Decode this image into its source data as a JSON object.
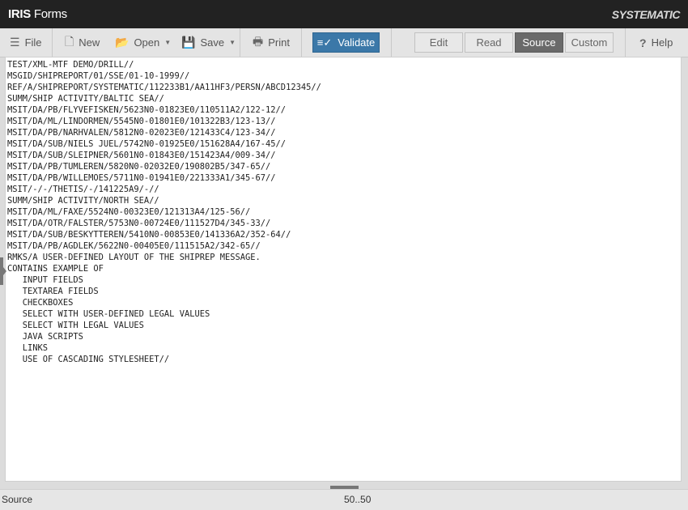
{
  "app": {
    "brand_bold": "IRIS",
    "brand_rest": " Forms",
    "vendor": "SYSTEMATIC"
  },
  "toolbar": {
    "file": "File",
    "new": "New",
    "open": "Open",
    "save": "Save",
    "print": "Print",
    "validate": "Validate",
    "help": "Help"
  },
  "modes": {
    "edit": "Edit",
    "read": "Read",
    "source": "Source",
    "custom": "Custom",
    "active": "Source"
  },
  "editor": {
    "lines": [
      "TEST/XML-MTF DEMO/DRILL//",
      "MSGID/SHIPREPORT/01/SSE/01-10-1999//",
      "REF/A/SHIPREPORT/SYSTEMATIC/112233B1/AA11HF3/PERSN/ABCD12345//",
      "SUMM/SHIP ACTIVITY/BALTIC SEA//",
      "MSIT/DA/PB/FLYVEFISKEN/5623N0-01823E0/110511A2/122-12//",
      "MSIT/DA/ML/LINDORMEN/5545N0-01801E0/101322B3/123-13//",
      "MSIT/DA/PB/NARHVALEN/5812N0-02023E0/121433C4/123-34//",
      "MSIT/DA/SUB/NIELS JUEL/5742N0-01925E0/151628A4/167-45//",
      "MSIT/DA/SUB/SLEIPNER/5601N0-01843E0/151423A4/009-34//",
      "MSIT/DA/PB/TUMLEREN/5820N0-02032E0/190802B5/347-65//",
      "MSIT/DA/PB/WILLEMOES/5711N0-01941E0/221333A1/345-67//",
      "MSIT/-/-/THETIS/-/141225A9/-//",
      "SUMM/SHIP ACTIVITY/NORTH SEA//",
      "MSIT/DA/ML/FAXE/5524N0-00323E0/121313A4/125-56//",
      "MSIT/DA/OTR/FALSTER/5753N0-00724E0/111527D4/345-33//",
      "MSIT/DA/SUB/BESKYTTEREN/5410N0-00853E0/141336A2/352-64//",
      "MSIT/DA/PB/AGDLEK/5622N0-00405E0/111515A2/342-65//",
      "RMKS/A USER-DEFINED LAYOUT OF THE SHIPREP MESSAGE.",
      "CONTAINS EXAMPLE OF",
      "   INPUT FIELDS",
      "   TEXTAREA FIELDS",
      "   CHECKBOXES",
      "   SELECT WITH USER-DEFINED LEGAL VALUES",
      "   SELECT WITH LEGAL VALUES",
      "   JAVA SCRIPTS",
      "   LINKS",
      "   USE OF CASCADING STYLESHEET//"
    ]
  },
  "status": {
    "mode": "Source",
    "position": "50..50"
  },
  "colors": {
    "titlebar": "#222222",
    "accent": "#3b78a8",
    "active_mode": "#6a6a6a"
  },
  "icons": [
    "menu-icon",
    "new-document-icon",
    "folder-icon",
    "save-icon",
    "printer-icon",
    "checklist-icon",
    "help-icon"
  ]
}
